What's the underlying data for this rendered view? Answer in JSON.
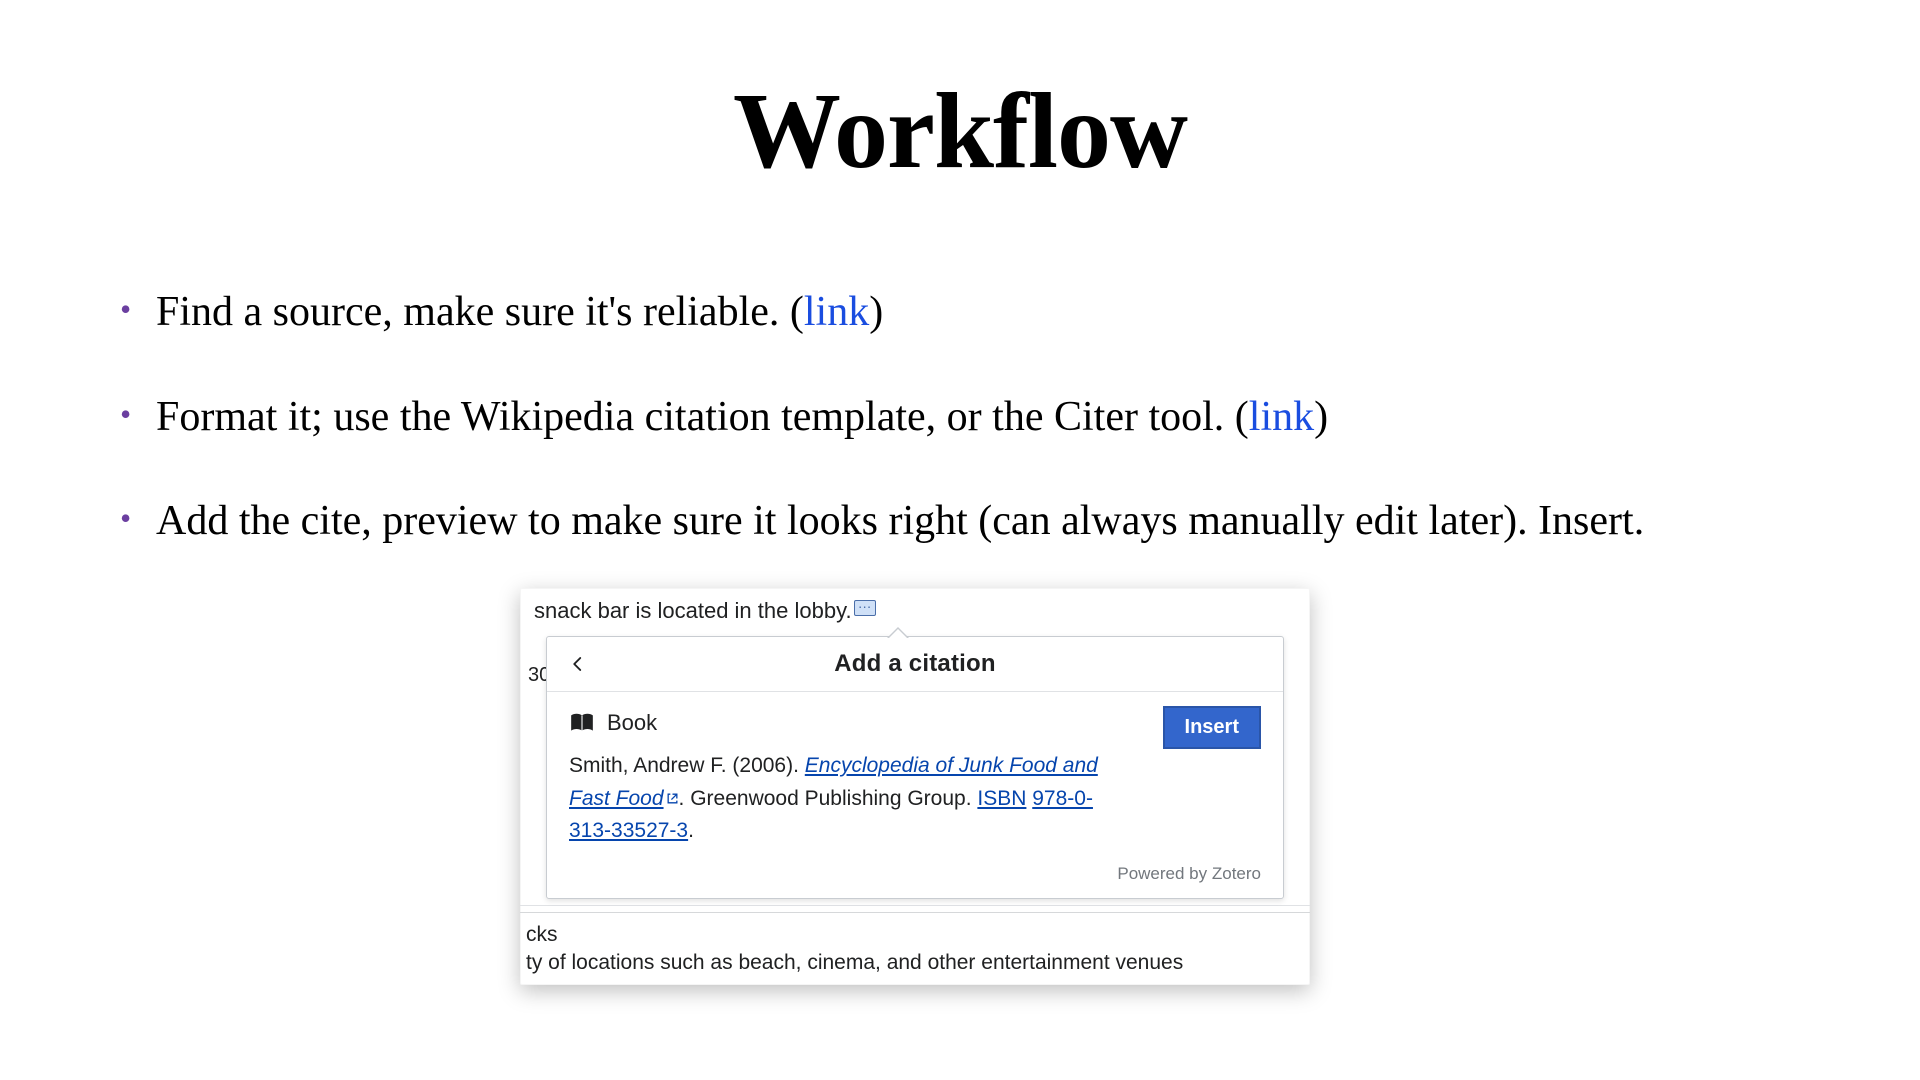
{
  "title": "Workflow",
  "bullets": [
    {
      "text": "Find a source, make sure it's reliable. ",
      "link_label": "link"
    },
    {
      "text": "Format it; use the Wikipedia citation template, or the Citer tool. ",
      "link_label": "link"
    },
    {
      "text": "Add the cite, preview to make sure it looks right (can always manually edit later). Insert."
    }
  ],
  "screenshot": {
    "context_line": "snack bar is located in the lobby.",
    "side_fragment": "30",
    "popup_title": "Add a citation",
    "source_type": "Book",
    "insert_label": "Insert",
    "citation": {
      "author_year": "Smith, Andrew F. (2006). ",
      "title_link": "Encyclopedia of Junk Food and Fast Food",
      "after_title": ". Greenwood Publishing Group. ",
      "isbn_label": "ISBN",
      "isbn_value": "978-0-313-33527-3",
      "trailing": "."
    },
    "powered_by": "Powered by Zotero",
    "cut_text_1": "cks",
    "cut_text_2": "ty of locations such as beach, cinema, and other entertainment venues"
  }
}
